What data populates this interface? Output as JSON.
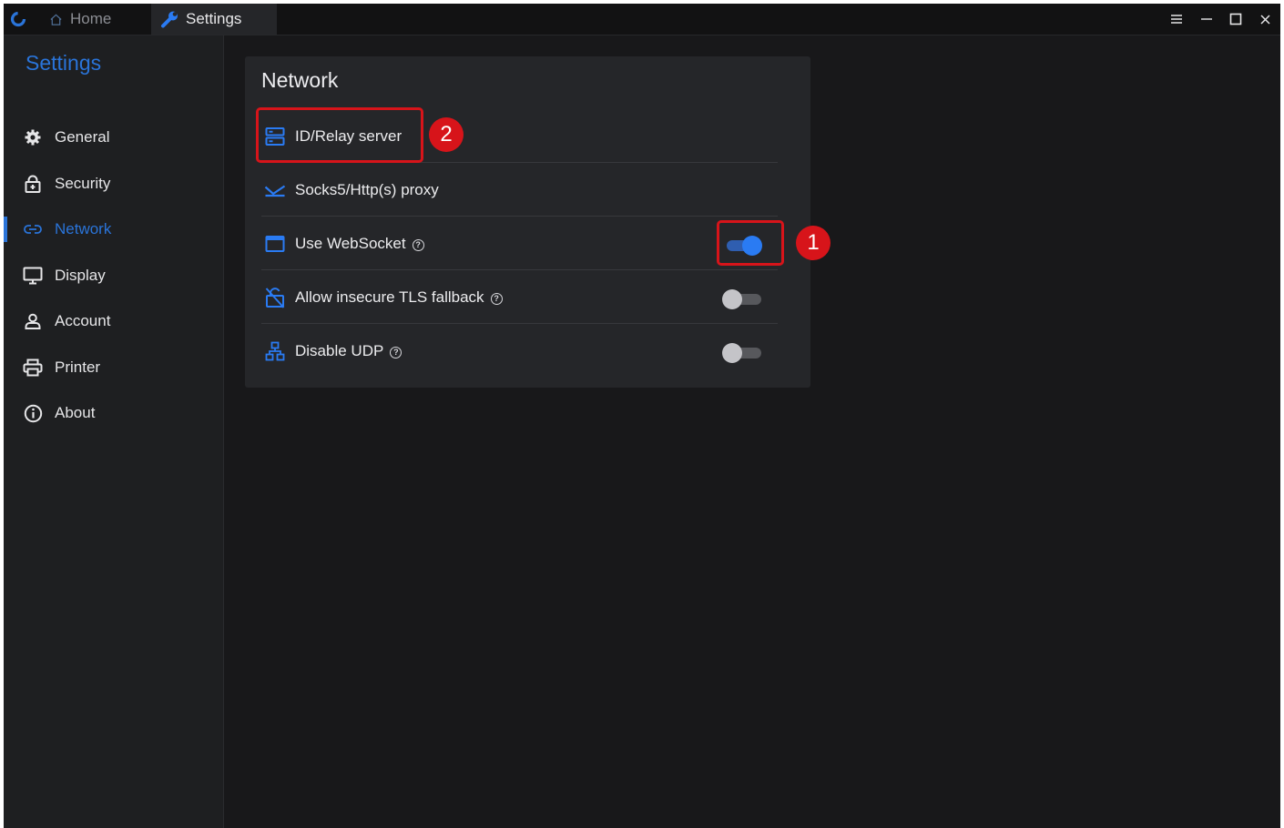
{
  "titlebar": {
    "tabs": [
      {
        "label": "Home",
        "icon": "home-icon"
      },
      {
        "label": "Settings",
        "icon": "wrench-icon"
      }
    ],
    "controls": [
      "menu-icon",
      "minimize-icon",
      "maximize-icon",
      "close-icon"
    ]
  },
  "sidebar": {
    "title": "Settings",
    "items": [
      {
        "label": "General",
        "icon": "gear-icon"
      },
      {
        "label": "Security",
        "icon": "lock-icon"
      },
      {
        "label": "Network",
        "icon": "link-icon",
        "active": true
      },
      {
        "label": "Display",
        "icon": "monitor-icon"
      },
      {
        "label": "Account",
        "icon": "user-icon"
      },
      {
        "label": "Printer",
        "icon": "printer-icon"
      },
      {
        "label": "About",
        "icon": "info-icon"
      }
    ]
  },
  "panel": {
    "title": "Network",
    "rows": [
      {
        "label": "ID/Relay server",
        "icon": "server-icon"
      },
      {
        "label": "Socks5/Http(s) proxy",
        "icon": "proxy-icon"
      },
      {
        "label": "Use WebSocket",
        "icon": "window-icon",
        "toggle": true
      },
      {
        "label": "Allow insecure TLS fallback",
        "icon": "unlock-icon",
        "toggle": false
      },
      {
        "label": "Disable UDP",
        "icon": "network-tree-icon",
        "toggle": false
      }
    ]
  },
  "annotations": {
    "badge1": "1",
    "badge2": "2"
  },
  "colors": {
    "accent": "#2a74d9",
    "annotation": "#d7141a",
    "background": "#18181a"
  }
}
